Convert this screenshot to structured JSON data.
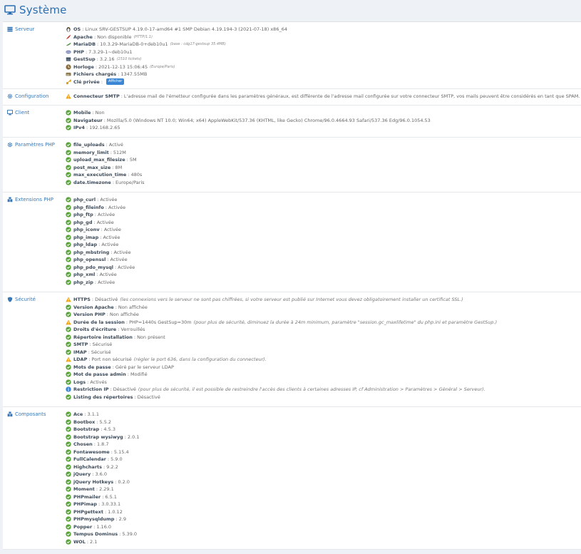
{
  "page": {
    "title": "Système"
  },
  "sections": {
    "serveur": {
      "label": "Serveur",
      "rows": [
        {
          "key": "OS",
          "value": "Linux SRV-GESTSUP 4.19.0-17-amd64 #1 SMP Debian 4.19.194-3 (2021-07-18) x86_64"
        },
        {
          "key": "Apache",
          "value": "Non disponible",
          "note": "(HTTP/1.1)"
        },
        {
          "key": "MariaDB",
          "value": "10.3.29-MariaDB-0+deb10u1",
          "note": "(base : cdg17-gestsup 35.4MB)"
        },
        {
          "key": "PHP",
          "value": "7.3.29-1~deb10u1"
        },
        {
          "key": "GestSup",
          "value": "3.2.16",
          "note": "(1510 tickets)"
        },
        {
          "key": "Horloge",
          "value": "2021-12-13 15:06:45",
          "note": "(Europe/Paris)"
        },
        {
          "key": "Fichiers chargés",
          "value": "1347.55MB"
        },
        {
          "key": "Clé privée",
          "value": "",
          "button": "Afficher"
        }
      ]
    },
    "configuration": {
      "label": "Configuration",
      "rows": [
        {
          "key": "Connecteur SMTP",
          "value": "L'adresse mail de l'émetteur configurée dans les paramètres généraux, est différente de l'adresse mail configurée sur votre connecteur SMTP, vos mails peuvent être considérés en tant que SPAM."
        }
      ]
    },
    "client": {
      "label": "Client",
      "rows": [
        {
          "key": "Mobile",
          "value": "Non"
        },
        {
          "key": "Navigateur",
          "value": "Mozilla/5.0 (Windows NT 10.0; Win64; x64) AppleWebKit/537.36 (KHTML, like Gecko) Chrome/96.0.4664.93 Safari/537.36 Edg/96.0.1054.53"
        },
        {
          "key": "IPv4",
          "value": "192.168.2.65"
        }
      ]
    },
    "php": {
      "label": "Paramètres PHP",
      "rows": [
        {
          "key": "file_uploads",
          "value": "Activé"
        },
        {
          "key": "memory_limit",
          "value": "512M"
        },
        {
          "key": "upload_max_filesize",
          "value": "5M"
        },
        {
          "key": "post_max_size",
          "value": "8M"
        },
        {
          "key": "max_execution_time",
          "value": "480s"
        },
        {
          "key": "date.timezone",
          "value": "Europe/Paris"
        }
      ]
    },
    "extensions": {
      "label": "Extensions PHP",
      "rows": [
        {
          "key": "php_curl",
          "value": "Activée"
        },
        {
          "key": "php_fileinfo",
          "value": "Activée"
        },
        {
          "key": "php_ftp",
          "value": "Activée"
        },
        {
          "key": "php_gd",
          "value": "Activée"
        },
        {
          "key": "php_iconv",
          "value": "Activée"
        },
        {
          "key": "php_imap",
          "value": "Activée"
        },
        {
          "key": "php_ldap",
          "value": "Activée"
        },
        {
          "key": "php_mbstring",
          "value": "Activée"
        },
        {
          "key": "php_openssl",
          "value": "Activée"
        },
        {
          "key": "php_pdo_mysql",
          "value": "Activée"
        },
        {
          "key": "php_xml",
          "value": "Activée"
        },
        {
          "key": "php_zip",
          "value": "Activée"
        }
      ]
    },
    "securite": {
      "label": "Sécurité",
      "rows": [
        {
          "key": "HTTPS",
          "value": "Désactivé",
          "note2": "(les connexions vers le serveur ne sont pas chiffrées, si votre serveur est publié sur Internet vous devez obligatoirement installer un certificat SSL.)"
        },
        {
          "key": "Version Apache",
          "value": "Non affichée"
        },
        {
          "key": "Version PHP",
          "value": "Non affichée"
        },
        {
          "key": "Durée de la session",
          "value": "PHP=1440s GestSup=30m",
          "note2": "(pour plus de sécurité, diminuez la durée à 24m minimum, paramètre \"session.gc_maxlifetime\" du php.ini et paramètre GestSup.)"
        },
        {
          "key": "Droits d'écriture",
          "value": "Verrouillés"
        },
        {
          "key": "Répertoire installation",
          "value": "Non présent"
        },
        {
          "key": "SMTP",
          "value": "Sécurisé"
        },
        {
          "key": "IMAP",
          "value": "Sécurisé"
        },
        {
          "key": "LDAP",
          "value": "Port non sécurisé",
          "note2": "(régler le port 636, dans la configuration du connecteur)."
        },
        {
          "key": "Mots de passe",
          "value": "Géré par le serveur LDAP"
        },
        {
          "key": "Mot de passe admin",
          "value": "Modifié"
        },
        {
          "key": "Logs",
          "value": "Activés"
        },
        {
          "key": "Restriction IP",
          "value": "Désactivé",
          "note2": "(pour plus de sécurité, il est possible de restreindre l'accès des clients à certaines adresses IP, cf Administration > Paramètres > Général > Serveur)."
        },
        {
          "key": "Listing des répertoires",
          "value": "Désactivé"
        }
      ]
    },
    "composants": {
      "label": "Composants",
      "rows": [
        {
          "key": "Ace",
          "value": "3.1.1"
        },
        {
          "key": "Bootbox",
          "value": "5.5.2"
        },
        {
          "key": "Bootstrap",
          "value": "4.5.3"
        },
        {
          "key": "Bootstrap wysiwyg",
          "value": "2.0.1"
        },
        {
          "key": "Chosen",
          "value": "1.8.7"
        },
        {
          "key": "Fontawesome",
          "value": "5.15.4"
        },
        {
          "key": "FullCalendar",
          "value": "5.9.0"
        },
        {
          "key": "Highcharts",
          "value": "9.2.2"
        },
        {
          "key": "jQuery",
          "value": "3.6.0"
        },
        {
          "key": "jQuery Hotkeys",
          "value": "0.2.0"
        },
        {
          "key": "Moment",
          "value": "2.29.1"
        },
        {
          "key": "PHPmailer",
          "value": "6.5.1"
        },
        {
          "key": "PHPimap",
          "value": "3.0.33.1"
        },
        {
          "key": "PHPgettext",
          "value": "1.0.12"
        },
        {
          "key": "PHPmysqldump",
          "value": "2.9"
        },
        {
          "key": "Popper",
          "value": "1.16.0"
        },
        {
          "key": "Tempus Dominus",
          "value": "5.39.0"
        },
        {
          "key": "WOL",
          "value": "2.1"
        }
      ]
    }
  },
  "colors": {
    "ok": "#5aa53b",
    "warn": "#f0a30a",
    "info": "#3a86d4",
    "accent": "#2b6fb3"
  }
}
